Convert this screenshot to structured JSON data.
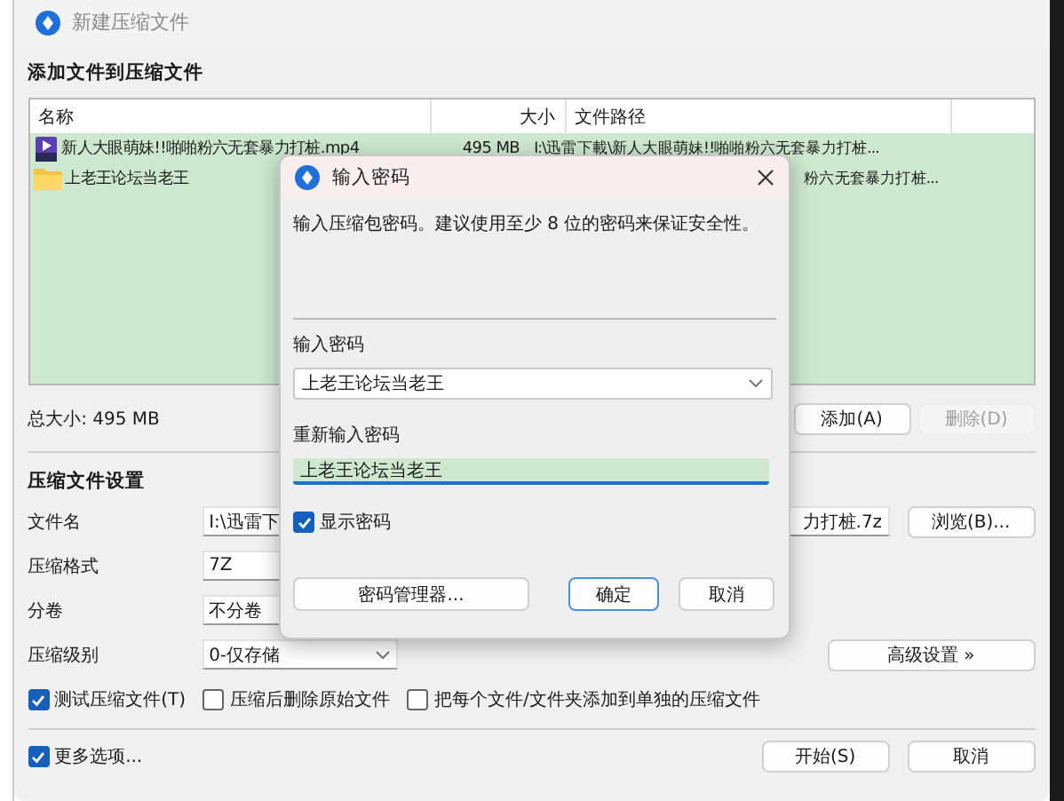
{
  "window": {
    "title": "新建压缩文件"
  },
  "add_section": {
    "heading": "添加文件到压缩文件"
  },
  "table": {
    "columns": [
      "名称",
      "大小",
      "文件路径"
    ],
    "rows": [
      {
        "kind": "video",
        "name": "新人大眼萌妹!!啪啪粉六无套暴力打桩.mp4",
        "size": "495 MB",
        "path": "I:\\迅雷下載\\新人大眼萌妹!!啪啪粉六无套暴力打桩...",
        "path_clipped": false
      },
      {
        "kind": "folder",
        "name": "上老王论坛当老王",
        "path": "粉六无套暴力打桩...",
        "path_clipped": true
      }
    ]
  },
  "total_size": "总大小: 495 MB",
  "list_buttons": [
    {
      "label": "添加(A)",
      "disabled": false
    },
    {
      "label": "删除(D)",
      "disabled": true
    }
  ],
  "settings": {
    "heading": "压缩文件设置",
    "file_name": {
      "label": "文件名",
      "value_start": "I:\\迅雷下",
      "value_end": "力打桩.7z",
      "button": "浏览(B)..."
    },
    "format": {
      "label": "压缩格式",
      "value": "7Z"
    },
    "volume": {
      "label": "分卷",
      "value": "不分卷"
    },
    "level": {
      "label": "压缩级别",
      "value": "0-仅存储"
    },
    "advanced_button": "高级设置 »",
    "options": [
      {
        "label": "测试压缩文件(T)",
        "checked": true
      },
      {
        "label": "压缩后删除原始文件",
        "checked": false
      },
      {
        "label": "把每个文件/文件夹添加到单独的压缩文件",
        "checked": false
      }
    ]
  },
  "more_options": {
    "label": "更多选项...",
    "checked": true
  },
  "footer_buttons": [
    "开始(S)",
    "取消"
  ],
  "password_dialog": {
    "title": "输入密码",
    "message": "输入压缩包密码。建议使用至少 8 位的密码来保证安全性。",
    "password_label": "输入密码",
    "password_value": "上老王论坛当老王",
    "confirm_label": "重新输入密码",
    "confirm_value": "上老王论坛当老王",
    "show_password": {
      "label": "显示密码",
      "checked": true
    },
    "buttons": [
      {
        "label": "密码管理器...",
        "default": false
      },
      {
        "label": "确定",
        "default": true
      },
      {
        "label": "取消",
        "default": false
      }
    ]
  }
}
